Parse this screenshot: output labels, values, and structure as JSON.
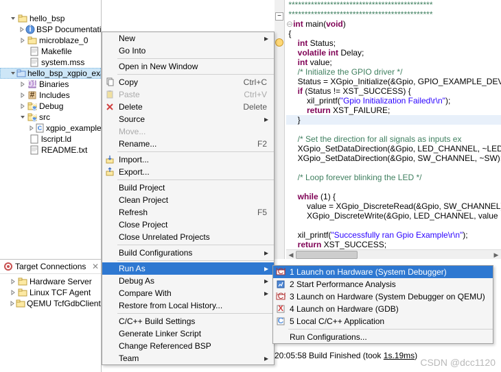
{
  "tree": {
    "hello_bsp": "hello_bsp",
    "bsp_doc": "BSP Documentation",
    "microblaze": "microblaze_0",
    "makefile": "Makefile",
    "system_mss": "system.mss",
    "selected": "hello_bsp_xgpio_exam",
    "binaries": "Binaries",
    "includes": "Includes",
    "debug": "Debug",
    "src": "src",
    "xgpio": "xgpio_example.",
    "lscript": "lscript.ld",
    "readme": "README.txt"
  },
  "targets": {
    "title": "Target Connections",
    "items": [
      "Hardware Server",
      "Linux TCF Agent",
      "QEMU TcfGdbClient"
    ]
  },
  "menu": {
    "new": "New",
    "go_into": "Go Into",
    "open_new": "Open in New Window",
    "copy": "Copy",
    "copy_key": "Ctrl+C",
    "paste": "Paste",
    "paste_key": "Ctrl+V",
    "delete": "Delete",
    "delete_key": "Delete",
    "source": "Source",
    "move": "Move...",
    "rename": "Rename...",
    "rename_key": "F2",
    "import": "Import...",
    "export": "Export...",
    "build": "Build Project",
    "clean": "Clean Project",
    "refresh": "Refresh",
    "refresh_key": "F5",
    "close_proj": "Close Project",
    "close_unrel": "Close Unrelated Projects",
    "build_conf": "Build Configurations",
    "run_as": "Run As",
    "debug_as": "Debug As",
    "compare": "Compare With",
    "restore": "Restore from Local History...",
    "cpp_build": "C/C++ Build Settings",
    "gen_linker": "Generate Linker Script",
    "change_bsp": "Change Referenced BSP",
    "team": "Team"
  },
  "submenu": {
    "launch_hw": "1 Launch on Hardware (System Debugger)",
    "perf": "2 Start Performance Analysis",
    "launch_qemu": "3 Launch on Hardware (System Debugger on QEMU)",
    "launch_gdb": "4 Launch on Hardware (GDB)",
    "local_cpp": "5 Local C/C++ Application",
    "run_conf": "Run Configurations..."
  },
  "code": {
    "stars1": "*********************************************",
    "stars2": "*********************************************",
    "decl_main1": "int",
    "decl_main2": " main(",
    "decl_main3": "void",
    "decl_main4": ")",
    "brace_o": "{",
    "l_status1": "int",
    "l_status2": " Status;",
    "l_delay1": "volatile int",
    "l_delay2": " Delay;",
    "l_value1": "int",
    "l_value2": " value;",
    "cmt_init": "/* Initialize the GPIO driver */",
    "l_init": "Status = XGpio_Initialize(&Gpio, GPIO_EXAMPLE_DEV",
    "l_if": "if",
    "l_if2": " (Status != XST_SUCCESS) {",
    "l_printf": "    xil_printf(",
    "l_printf_str": "\"Gpio Initialization Failed\\r\\n\"",
    "l_printf_end": ");",
    "l_return": "return",
    "l_return2": " XST_FAILURE;",
    "brace_c": "}",
    "cmt_dir": "/* Set the direction for all signals as inputs ex",
    "l_setdir1": "XGpio_SetDataDirection(&Gpio, LED_CHANNEL, ~LED);",
    "l_setdir2": "XGpio_SetDataDirection(&Gpio, SW_CHANNEL, ~SW);",
    "cmt_loop": "/* Loop forever blinking the LED */",
    "l_while": "while",
    "l_while2": " (1) {",
    "l_read": "    value = XGpio_DiscreteRead(&Gpio, SW_CHANNEL)",
    "l_write": "    XGpio_DiscreteWrite(&Gpio, LED_CHANNEL, value",
    "l_printf2": "xil_printf(",
    "l_printf2_str": "\"Successfully ran Gpio Example\\r\\n\"",
    "l_printf2_end": ");",
    "l_return3": "return",
    "l_return3_2": " XST_SUCCESS;"
  },
  "console": {
    "time": "20:05:58 ",
    "msg1": "Build Finished (took ",
    "msg2": "1s.19ms",
    "msg3": ")"
  },
  "watermark": "CSDN @dcc1120"
}
